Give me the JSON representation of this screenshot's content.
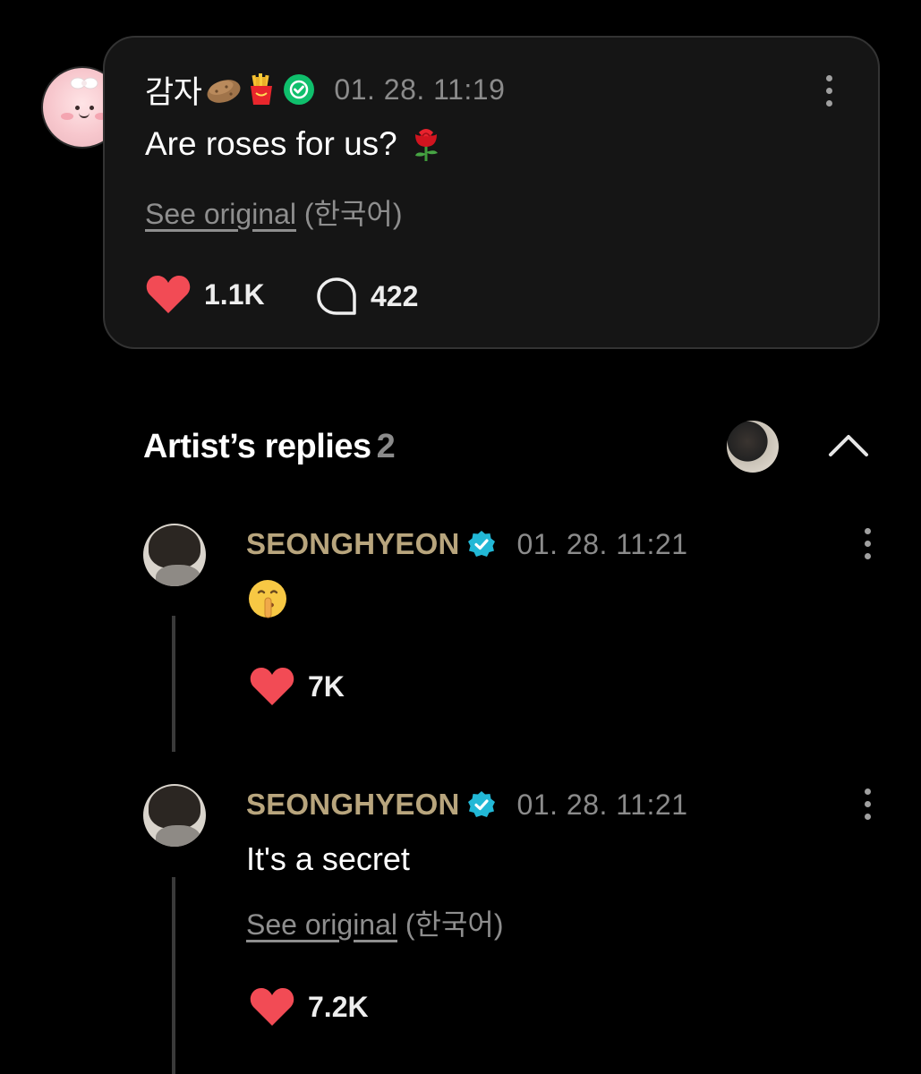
{
  "post": {
    "author": "감자",
    "author_icons": [
      "potato-emoji",
      "fries-emoji",
      "green-verified-badge"
    ],
    "time": "01. 28. 11:19",
    "text": "Are roses for us?",
    "text_icon": "rose-emoji",
    "see_original": "See original",
    "language": "(한국어)",
    "likes": "1.1K",
    "comments": "422"
  },
  "replies_section": {
    "title": "Artist’s replies",
    "count": "2"
  },
  "replies": [
    {
      "author": "SEONGHYEON",
      "time": "01. 28. 11:21",
      "text_icon": "shushing-face-emoji",
      "likes": "7K"
    },
    {
      "author": "SEONGHYEON",
      "time": "01. 28. 11:21",
      "text": "It's a secret",
      "see_original": "See original",
      "language": "(한국어)",
      "likes": "7.2K"
    }
  ],
  "colors": {
    "background": "#000000",
    "card": "#151515",
    "heart": "#f24b55",
    "artist_name": "#b8a57d",
    "verified_green": "#0fbf6c",
    "verified_blue": "#22b8d6",
    "muted_text": "#8b8b8b"
  }
}
